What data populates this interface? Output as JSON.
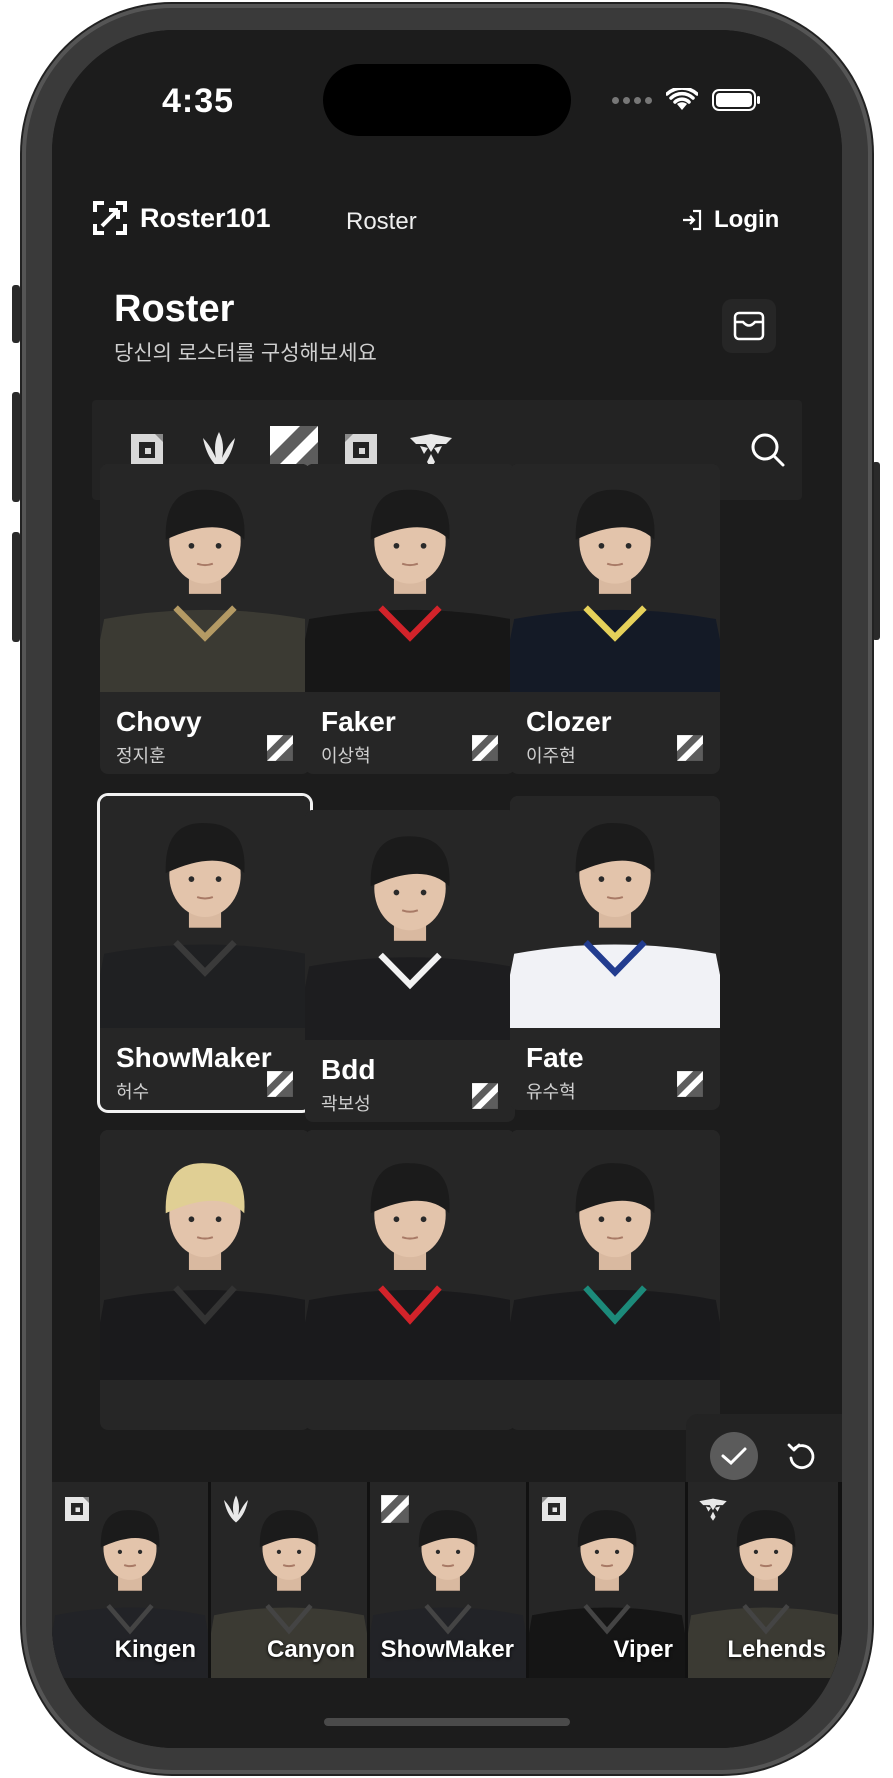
{
  "status": {
    "time": "4:35"
  },
  "header": {
    "brand": "Roster101",
    "nav": "Roster",
    "login": "Login"
  },
  "page": {
    "title": "Roster",
    "subtitle": "당신의 로스터를 구성해보세요"
  },
  "filters": {
    "teams": [
      "gen-g-icon",
      "kt-rolster-icon",
      "t1-icon",
      "gen-g-alt-icon",
      "nongshim-icon"
    ],
    "search_icon": "search-icon"
  },
  "players": [
    {
      "name": "Chovy",
      "kname": "정지훈",
      "team_icon": "t1-icon",
      "selected": false,
      "shirt": "#3b3a33",
      "trim": "#b49a64",
      "hair": "#1b1b1b"
    },
    {
      "name": "Faker",
      "kname": "이상혁",
      "team_icon": "t1-icon",
      "selected": false,
      "shirt": "#171717",
      "trim": "#d2232a",
      "hair": "#1b1b1b"
    },
    {
      "name": "Clozer",
      "kname": "이주현",
      "team_icon": "t1-icon",
      "selected": false,
      "shirt": "#141a26",
      "trim": "#e6d15a",
      "hair": "#1b1b1b"
    },
    {
      "name": "ShowMaker",
      "kname": "허수",
      "team_icon": "t1-icon",
      "selected": true,
      "shirt": "#1f2022",
      "trim": "#3a3a3a",
      "hair": "#1b1b1b"
    },
    {
      "name": "Bdd",
      "kname": "곽보성",
      "team_icon": "t1-icon",
      "selected": false,
      "shirt": "#1d1d1f",
      "trim": "#f2f2f2",
      "hair": "#1b1b1b"
    },
    {
      "name": "Fate",
      "kname": "유수혁",
      "team_icon": "t1-icon",
      "selected": false,
      "shirt": "#f1f2f6",
      "trim": "#223c8f",
      "hair": "#1b1b1b"
    },
    {
      "name": "",
      "kname": "",
      "team_icon": "",
      "selected": false,
      "shirt": "#1a1a1c",
      "trim": "#333",
      "hair": "#e0cf94"
    },
    {
      "name": "",
      "kname": "",
      "team_icon": "",
      "selected": false,
      "shirt": "#1a1a1c",
      "trim": "#d2232a",
      "hair": "#1b1b1b"
    },
    {
      "name": "",
      "kname": "",
      "team_icon": "",
      "selected": false,
      "shirt": "#1a1a1c",
      "trim": "#1c8a7a",
      "hair": "#1b1b1b"
    }
  ],
  "roster": [
    {
      "name": "Kingen",
      "team_icon": "gen-g-icon",
      "shirt": "#222327"
    },
    {
      "name": "Canyon",
      "team_icon": "kt-rolster-icon",
      "shirt": "#3b3a33"
    },
    {
      "name": "ShowMaker",
      "team_icon": "t1-icon",
      "shirt": "#222327"
    },
    {
      "name": "Viper",
      "team_icon": "gen-g-alt-icon",
      "shirt": "#151515"
    },
    {
      "name": "Lehends",
      "team_icon": "nongshim-icon",
      "shirt": "#3b3a33"
    }
  ],
  "actions": {
    "confirm_icon": "check-icon",
    "reset_icon": "reset-icon"
  },
  "colors": {
    "background": "#1c1c1c",
    "card": "#262626",
    "accent": "#ffffff"
  }
}
